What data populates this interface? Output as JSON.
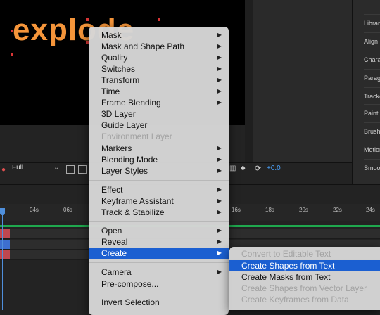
{
  "composition": {
    "text_layer_content": "explode",
    "text_color": "#f5953a"
  },
  "right_panel": {
    "items": [
      "Libraries",
      "Align",
      "Character",
      "Paragraph",
      "Tracker",
      "Paint",
      "Brushes",
      "Motion",
      "Smooth"
    ]
  },
  "viewer_toolbar": {
    "resolution": "Full",
    "exposure": "+0.0"
  },
  "timeline": {
    "ruler_ticks": [
      "04s",
      "06s",
      "16s",
      "18s",
      "20s",
      "22s",
      "24s"
    ]
  },
  "context_menu": {
    "items": [
      {
        "label": "Mask",
        "has_submenu": true,
        "disabled": false
      },
      {
        "label": "Mask and Shape Path",
        "has_submenu": true,
        "disabled": false
      },
      {
        "label": "Quality",
        "has_submenu": true,
        "disabled": false
      },
      {
        "label": "Switches",
        "has_submenu": true,
        "disabled": false
      },
      {
        "label": "Transform",
        "has_submenu": true,
        "disabled": false
      },
      {
        "label": "Time",
        "has_submenu": true,
        "disabled": false
      },
      {
        "label": "Frame Blending",
        "has_submenu": true,
        "disabled": false
      },
      {
        "label": "3D Layer",
        "has_submenu": false,
        "disabled": false
      },
      {
        "label": "Guide Layer",
        "has_submenu": false,
        "disabled": false
      },
      {
        "label": "Environment Layer",
        "has_submenu": false,
        "disabled": true
      },
      {
        "label": "Markers",
        "has_submenu": true,
        "disabled": false
      },
      {
        "label": "Blending Mode",
        "has_submenu": true,
        "disabled": false
      },
      {
        "label": "Layer Styles",
        "has_submenu": true,
        "disabled": false
      },
      {
        "label": "Effect",
        "has_submenu": true,
        "disabled": false
      },
      {
        "label": "Keyframe Assistant",
        "has_submenu": true,
        "disabled": false
      },
      {
        "label": "Track & Stabilize",
        "has_submenu": true,
        "disabled": false
      },
      {
        "label": "Open",
        "has_submenu": true,
        "disabled": false
      },
      {
        "label": "Reveal",
        "has_submenu": true,
        "disabled": false
      },
      {
        "label": "Create",
        "has_submenu": true,
        "disabled": false,
        "highlighted": true
      },
      {
        "label": "Camera",
        "has_submenu": true,
        "disabled": false
      },
      {
        "label": "Pre-compose...",
        "has_submenu": false,
        "disabled": false
      },
      {
        "label": "Invert Selection",
        "has_submenu": false,
        "disabled": false
      }
    ]
  },
  "create_submenu": {
    "items": [
      {
        "label": "Convert to Editable Text",
        "disabled": true
      },
      {
        "label": "Create Shapes from Text",
        "disabled": false,
        "highlighted": true
      },
      {
        "label": "Create Masks from Text",
        "disabled": false
      },
      {
        "label": "Create Shapes from Vector Layer",
        "disabled": true
      },
      {
        "label": "Create Keyframes from Data",
        "disabled": true
      }
    ]
  },
  "colors": {
    "selection": "#1b5fd1",
    "work_area": "#1fa84e",
    "playhead": "#4f8fdc",
    "exposure": "#4aa3ff"
  }
}
